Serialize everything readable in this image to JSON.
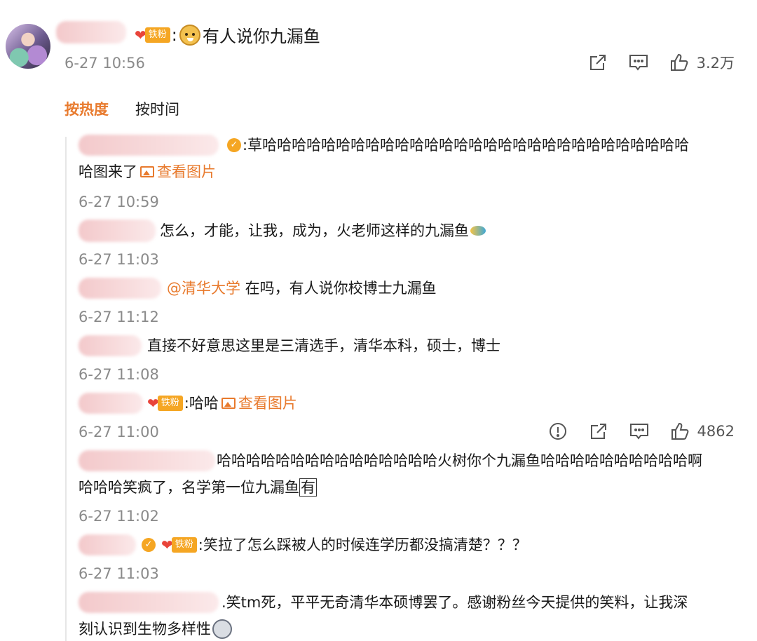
{
  "post": {
    "comment_text": "有人说你九漏鱼",
    "time": "6-27 10:56",
    "likes": "3.2万",
    "fan_badge": "铁粉"
  },
  "tabs": {
    "hot": "按热度",
    "time": "按时间"
  },
  "replies": [
    {
      "text": ":草哈哈哈哈哈哈哈哈哈哈哈哈哈哈哈哈哈哈哈哈哈哈哈哈哈哈哈哈哈哈哈哈哈哈哈哈哈哈哈哈哈哈哈哈哈哈哈哈哈哈哈哈哈哈哈哈哈哈哈哈哈哈哈哈哈哈",
      "text_line1": ":草哈哈哈哈哈哈哈哈哈哈哈哈哈哈哈哈哈哈哈哈哈哈哈哈哈哈哈哈哈",
      "text_line2": "哈图来了",
      "link": "查看图片",
      "time": "6-27 10:59"
    },
    {
      "text": "怎么，才能，让我，成为，火老师这样的九漏鱼",
      "time": "6-27 11:03"
    },
    {
      "mention": "@清华大学",
      "text": " 在吗，有人说你校博士九漏鱼",
      "time": "6-27 11:12"
    },
    {
      "text": "直接不好意思这里是三清选手，清华本科，硕士，博士",
      "time": "6-27 11:08"
    },
    {
      "fan_badge": "铁粉",
      "text": ":哈哈",
      "link": "查看图片",
      "time": "6-27 11:00",
      "likes": "4862"
    },
    {
      "text_line1": "哈哈哈哈哈哈哈哈哈哈哈哈哈哈哈火树你个九漏鱼哈哈哈哈哈哈哈哈哈哈啊",
      "text_line2": "哈哈哈笑疯了，名学第一位九漏鱼",
      "boxed": "有",
      "time": "6-27 11:02"
    },
    {
      "fan_badge": "铁粉",
      "text": ":笑拉了怎么踩被人的时候连学历都没搞清楚？？？",
      "time": "6-27 11:03"
    },
    {
      "text_line1": ".笑tm死，平平无奇清华本硕博罢了。感谢粉丝今天提供的笑料，让我深",
      "text_line2": "刻认识到生物多样性"
    }
  ],
  "colors": {
    "accent": "#e87a2d",
    "badge": "#f5a623",
    "muted": "#8a8a8a"
  }
}
